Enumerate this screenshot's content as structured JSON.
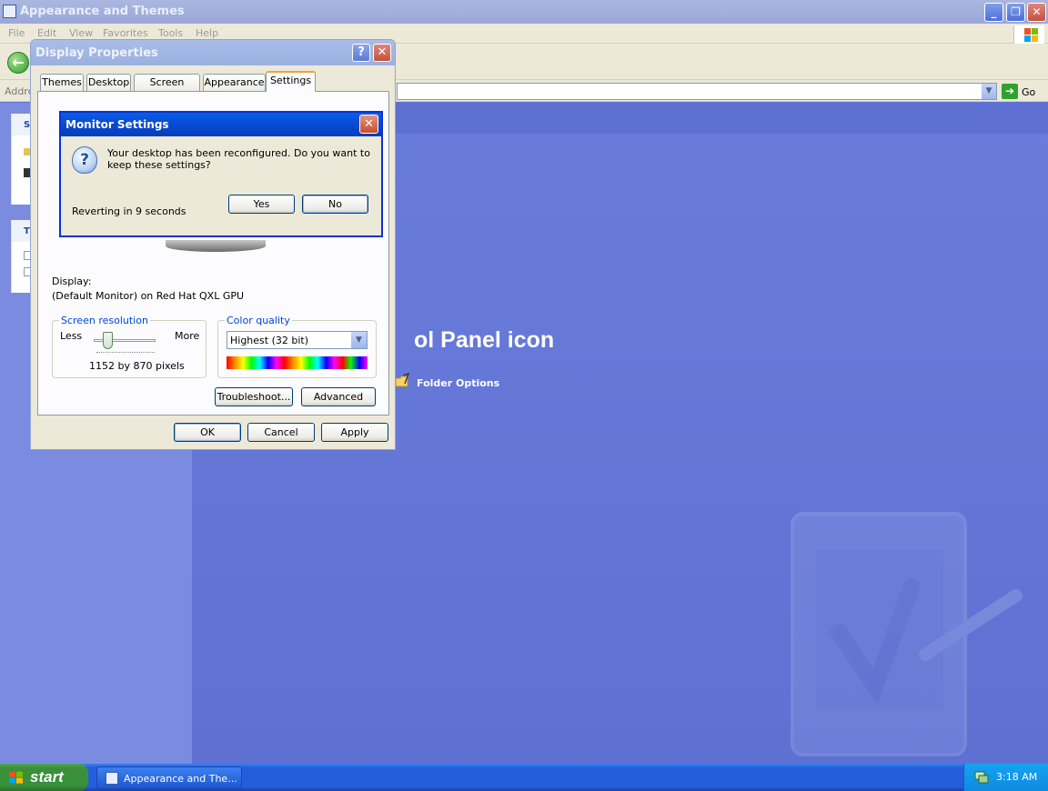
{
  "explorer": {
    "title": "Appearance and Themes",
    "menu": [
      "File",
      "Edit",
      "View",
      "Favorites",
      "Tools",
      "Help"
    ],
    "address_label": "Addre",
    "go_label": "Go",
    "left_pane": {
      "box1_header": "S",
      "box2_header": "T"
    },
    "heading": "ol Panel icon",
    "folder_options": "Folder Options"
  },
  "display_properties": {
    "title": "Display Properties",
    "tabs": [
      "Themes",
      "Desktop",
      "Screen Saver",
      "Appearance",
      "Settings"
    ],
    "active_tab": "Settings",
    "display_label": "Display:",
    "display_value": "(Default Monitor) on Red Hat QXL GPU",
    "screen_resolution": {
      "title": "Screen resolution",
      "less": "Less",
      "more": "More",
      "value": "1152 by 870 pixels"
    },
    "color_quality": {
      "title": "Color quality",
      "selected": "Highest (32 bit)"
    },
    "buttons": {
      "troubleshoot": "Troubleshoot...",
      "advanced": "Advanced",
      "ok": "OK",
      "cancel": "Cancel",
      "apply": "Apply"
    },
    "help_glyph": "?",
    "close_glyph": "✕"
  },
  "monitor_settings": {
    "title": "Monitor Settings",
    "message": "Your desktop has been reconfigured.  Do you want to keep these settings?",
    "reverting": "Reverting in 9 seconds",
    "yes": "Yes",
    "no": "No"
  },
  "taskbar": {
    "start": "start",
    "task": "Appearance and The...",
    "clock": "3:18 AM"
  },
  "colors": {
    "desktop_bg": "#6375d6",
    "taskbar": "#245edb",
    "start": "#3c8f3a",
    "dialog": "#ece9d8",
    "active_title": "#0a5ee6"
  },
  "icons": [
    "window-icon",
    "minimize-icon",
    "restore-icon",
    "close-icon",
    "windows-logo-icon",
    "back-arrow-icon",
    "go-arrow-icon",
    "folder-options-icon",
    "question-icon",
    "network-icon",
    "windows-flag-icon"
  ]
}
